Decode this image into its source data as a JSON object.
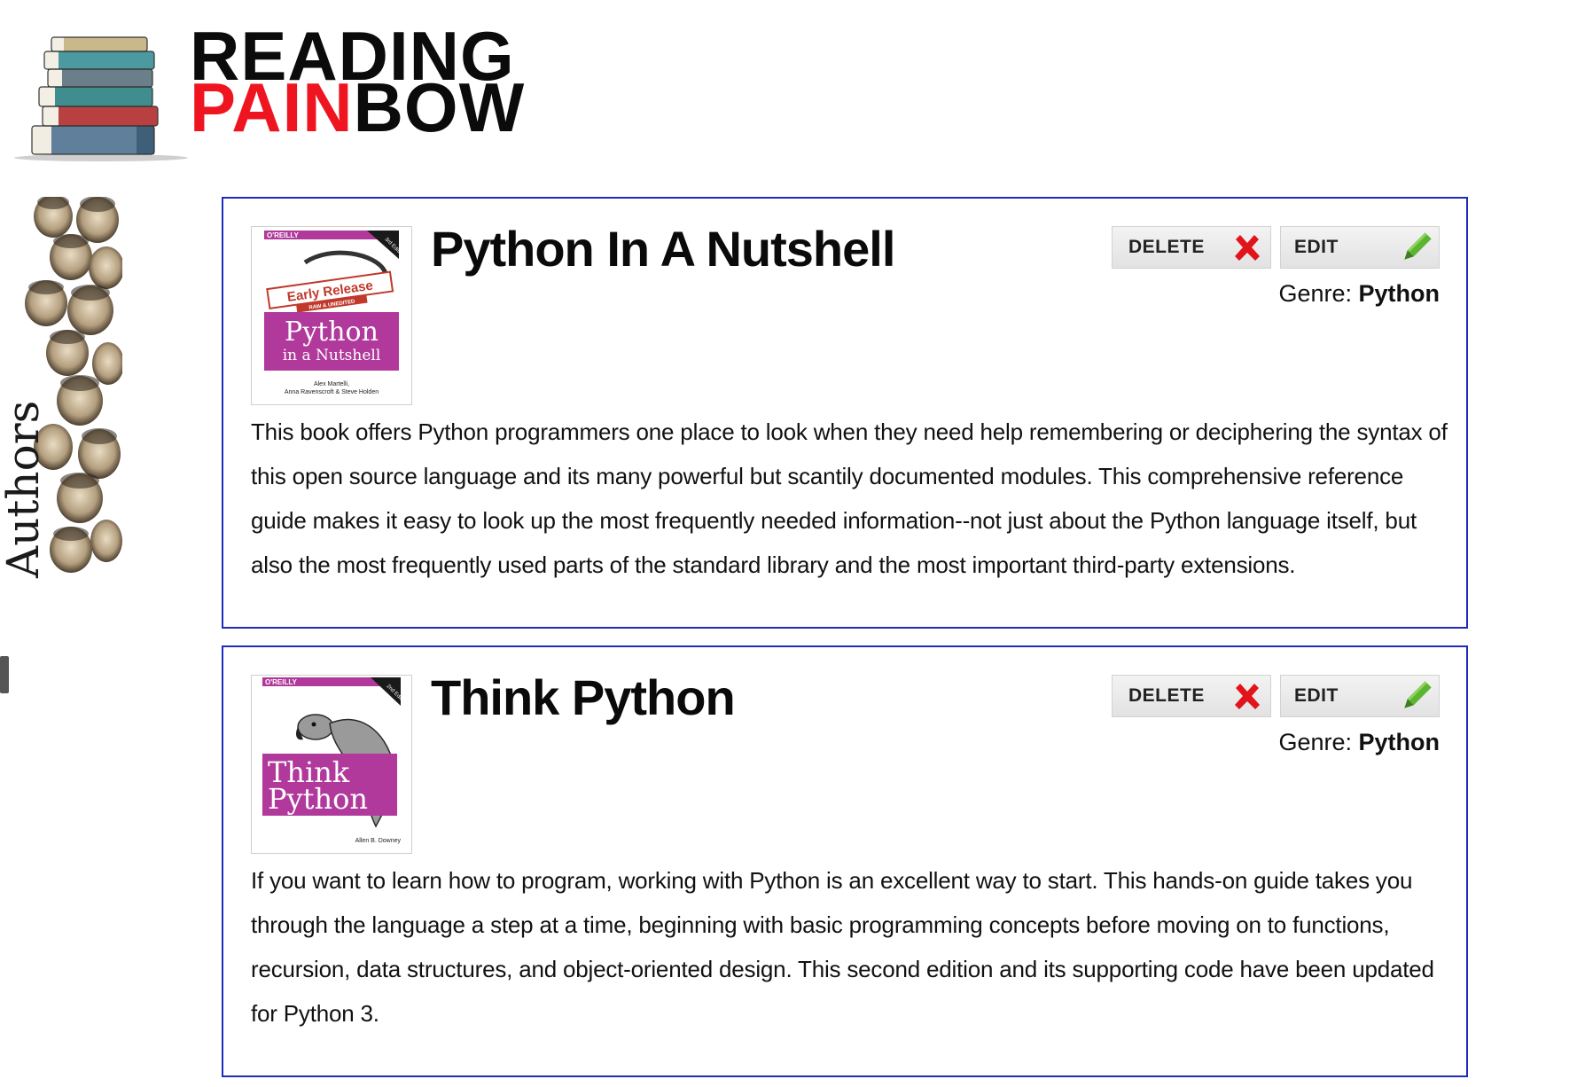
{
  "logo": {
    "line1": "READING",
    "line2_red": "PAIN",
    "line2_black": "BOW"
  },
  "sidebar": {
    "authors_label": "Authors"
  },
  "books": [
    {
      "title": "Python In A Nutshell",
      "cover": {
        "publisher": "O'REILLY",
        "edition": "3rd Edition",
        "badge_main": "Early Release",
        "badge_sub": "RAW & UNEDITED",
        "cover_title_line1": "Python",
        "cover_title_line2": "in a Nutshell",
        "authors_line1": "Alex Martelli,",
        "authors_line2": "Anna Ravenscroft & Steve Holden"
      },
      "delete_label": "DELETE",
      "edit_label": "EDIT",
      "genre_label": "Genre: ",
      "genre_value": "Python",
      "description": "This book offers Python programmers one place to look when they need help remembering or deciphering the syntax of this open source language and its many powerful but scantily documented modules. This comprehensive reference guide makes it easy to look up the most frequently needed information--not just about the Python language itself, but also the most frequently used parts of the standard library and the most important third-party extensions."
    },
    {
      "title": "Think Python",
      "cover": {
        "publisher": "O'REILLY",
        "edition": "2nd Edition",
        "cover_title_line1": "Think",
        "cover_title_line2": "Python",
        "author": "Allen B. Downey"
      },
      "delete_label": "DELETE",
      "edit_label": "EDIT",
      "genre_label": "Genre: ",
      "genre_value": "Python",
      "description": "If you want to learn how to program, working with Python is an excellent way to start. This hands-on guide takes you through the language a step at a time, beginning with basic programming concepts before moving on to functions, recursion, data structures, and object-oriented design. This second edition and its supporting code have been updated for Python 3."
    }
  ],
  "icons": {
    "delete": "red-x-icon",
    "edit": "green-pencil-icon"
  },
  "colors": {
    "card_border": "#1f2bbd",
    "logo_red": "#ef1520",
    "cover_purple": "#b0399b",
    "delete_red": "#e2141b",
    "edit_green": "#5cb531"
  }
}
